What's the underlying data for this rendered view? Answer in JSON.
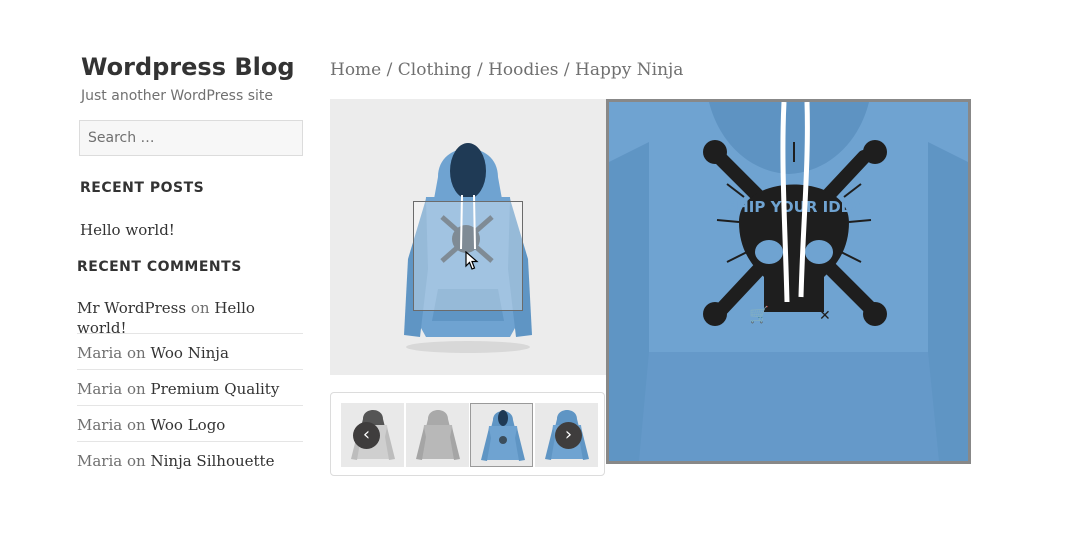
{
  "site": {
    "title": "Wordpress Blog",
    "description": "Just another WordPress site"
  },
  "search": {
    "placeholder": "Search …"
  },
  "recent_posts": {
    "title": "RECENT POSTS",
    "items": [
      "Hello world!"
    ]
  },
  "recent_comments": {
    "title": "RECENT COMMENTS",
    "on_word": "on",
    "items": [
      {
        "author": "Mr WordPress",
        "post": "Hello world!"
      },
      {
        "author": "Maria",
        "post": "Woo Ninja"
      },
      {
        "author": "Maria",
        "post": "Premium Quality"
      },
      {
        "author": "Maria",
        "post": "Woo Logo"
      },
      {
        "author": "Maria",
        "post": "Ninja Silhouette"
      }
    ]
  },
  "breadcrumb": {
    "items": [
      "Home",
      "Clothing",
      "Hoodies",
      "Happy Ninja"
    ],
    "separator": "/"
  },
  "gallery": {
    "prev_label": "‹",
    "next_label": "›",
    "active_thumbnail": 3,
    "thumbnail_count": 4
  },
  "graphic_text": "SHIP YOUR IDEA",
  "colors": {
    "hoodie_blue": "#6fa3d1",
    "hoodie_light_blue": "#a9cbe5",
    "zoom_border": "#888888",
    "nav_button": "#3f3d3d"
  }
}
